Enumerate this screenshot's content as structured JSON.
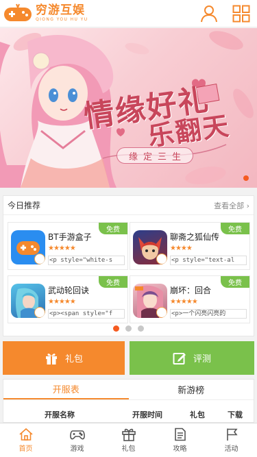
{
  "header": {
    "logo_text": "穷游互娱",
    "logo_sub": "QIONG YOU HU YU",
    "brand_color": "#f5892d",
    "icons": [
      "user-icon",
      "grid-menu-icon"
    ]
  },
  "banner": {
    "title_line1": "情缘好礼",
    "title_line2": "乐翻天",
    "subtitle": "缘定三生",
    "active_slide": 1
  },
  "recommend": {
    "title": "今日推荐",
    "more_label": "查看全部",
    "games": [
      {
        "name": "BT手游盒子",
        "stars": "★★★★★",
        "desc": "<p style=\"white-s",
        "tag": "免费"
      },
      {
        "name": "聊斋之狐仙传",
        "stars": "★★★★",
        "desc": "<p style=\"text-al",
        "tag": "免费"
      },
      {
        "name": "武动轮回诀",
        "stars": "★★★★★",
        "desc": "<p><span style=\"f",
        "tag": "免费"
      },
      {
        "name": "崩坏：回合",
        "stars": "★★★★★",
        "desc": "<p>一个闪亮闪亮的",
        "tag": "免费"
      }
    ],
    "pager_active": 1,
    "pager_count": 3
  },
  "actions": {
    "gift_label": "礼包",
    "review_label": "评测",
    "gift_color": "#f5892d",
    "review_color": "#7ac14b"
  },
  "server": {
    "tabs": [
      "开服表",
      "新游榜"
    ],
    "active_tab": 0,
    "columns": [
      "开服名称",
      "开服时间",
      "礼包",
      "下载"
    ]
  },
  "nav": {
    "items": [
      "首页",
      "游戏",
      "礼包",
      "攻略",
      "活动"
    ],
    "active": 0
  }
}
